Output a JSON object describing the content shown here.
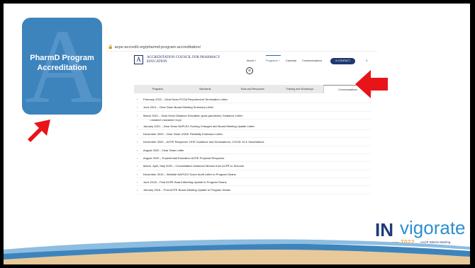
{
  "tile": {
    "label": "PharmD Program Accreditation",
    "letter": "A"
  },
  "browser": {
    "url": "acpe-accredit.org/pharmd-program-accreditation/"
  },
  "site": {
    "logo_letter": "A",
    "org_name": "ACCREDITATION COUNCIL FOR PHARMACY EDUCATION",
    "nav": {
      "about": "About ˅",
      "programs": "Programs ˅",
      "calendar": "Calendar",
      "communications": "Communications",
      "contact": "✉ CONTACT",
      "search": "⌕"
    },
    "circle_icon": "⊖",
    "tabs": [
      "Programs",
      "Standards",
      "Tools and Resources",
      "Training and Workshops",
      "Communications"
    ],
    "active_tab": "Communications",
    "letters": [
      "February 2022 – Dear Dean PCOA Requirement Termination Letter",
      "June 2021 – Dear Dean Board Meeting Summary Letter",
      "March 2021 – Dear Dean Distance Education (post-pandemic) Guidance Letter",
      "January 2021 – Dear Dean NAPLEX Scoring Changes and Board Meeting Update Letter",
      "December 2020 – Dear Dean USDE Flexibility Extension Letter",
      "November 2020 – ACPE Response: HHS Guidance and Declarations; COVID 19 & Vaccinations",
      "August 2020 – Dear Dean Letter",
      "August 2020 – Experiential Education ACPE Proposal Response",
      "March, April, May 2020 – Consolidated Guidance Memos from ACPE to Schools",
      "December 2019 – Website NAPLEX Score Audit Letter to Program Deans",
      "June 2018 – Post ACPE Board Meeting Update to Program Deans",
      "January 2018 – Post ACPE Board Meeting Update to Program Deans"
    ],
    "sub_item": "Distance Education FAQs"
  },
  "brand": {
    "in": "IN",
    "vigorate": "vigorate",
    "year": "2022",
    "tagline": "AACP INterim Meeting"
  },
  "colors": {
    "tile": "#3d84bd",
    "arrow": "#e8141a",
    "brand_dark": "#1e3a78",
    "brand_light": "#2a8fd0",
    "brand_orange": "#f4a23a"
  }
}
